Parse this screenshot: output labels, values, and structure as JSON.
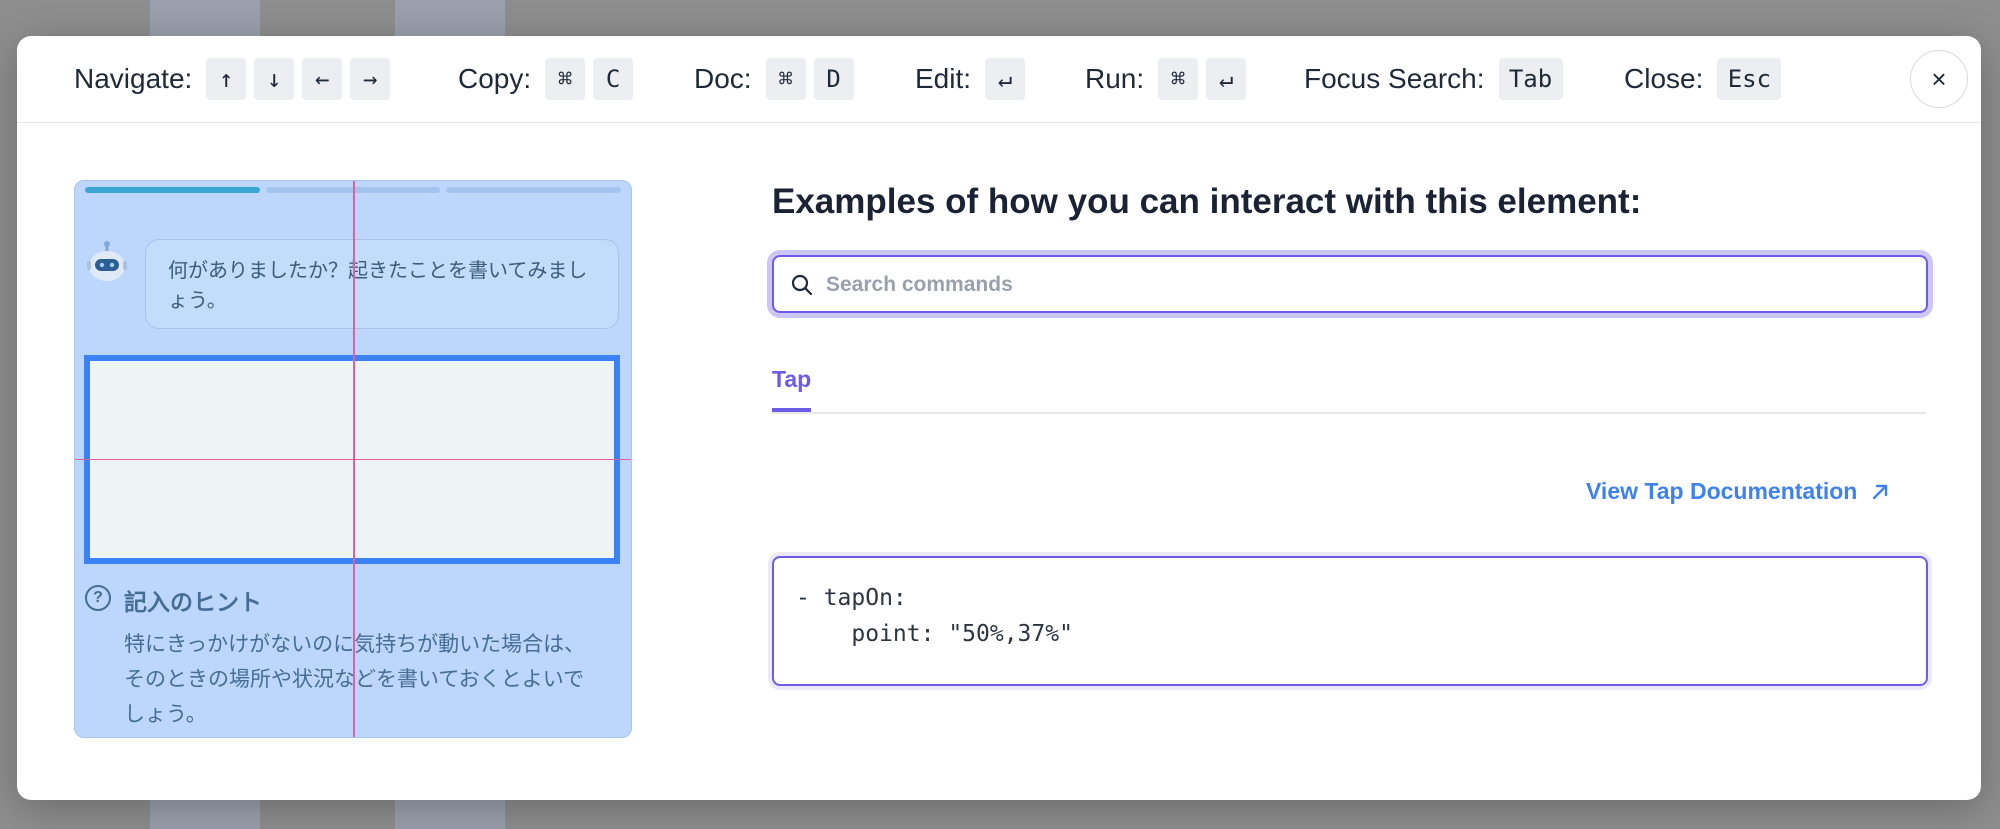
{
  "shortcuts": {
    "navigate": {
      "label": "Navigate:",
      "keys": [
        "↑",
        "↓",
        "←",
        "→"
      ]
    },
    "copy": {
      "label": "Copy:",
      "keys": [
        "⌘",
        "C"
      ]
    },
    "doc": {
      "label": "Doc:",
      "keys": [
        "⌘",
        "D"
      ]
    },
    "edit": {
      "label": "Edit:",
      "keys": [
        "↵"
      ]
    },
    "run": {
      "label": "Run:",
      "keys": [
        "⌘",
        "↵"
      ]
    },
    "focus_search": {
      "label": "Focus Search:",
      "keys": [
        "Tab"
      ]
    },
    "close": {
      "label": "Close:",
      "keys": [
        "Esc"
      ]
    }
  },
  "close_button": {
    "icon": "close-icon",
    "glyph": "×"
  },
  "preview": {
    "progress_segments": 3,
    "progress_active": 1,
    "bubble_text": "何がありましたか？起きたことを書いてみましょう。",
    "hint_icon_glyph": "?",
    "hint_title": "記入のヒント",
    "hint_body": "特にきっかけがないのに気持ちが動いた場合は、そのときの場所や状況などを書いておくとよいでしょう。",
    "colors": {
      "background": "#bcd7fb",
      "input_border": "#3b82f6",
      "crosshair": "#e45fa0",
      "hint_text": "#466d95"
    }
  },
  "panel": {
    "heading": "Examples of how you can interact with this element:",
    "search": {
      "placeholder": "Search commands",
      "value": ""
    },
    "tabs": [
      {
        "label": "Tap",
        "active": true
      }
    ],
    "doc_link": {
      "label": "View Tap Documentation",
      "icon": "arrow-up-right-icon"
    },
    "code": "- tapOn:\n    point: \"50%,37%\""
  },
  "colors": {
    "accent": "#6d5ce6",
    "link": "#3f82ee",
    "text": "#1a2233"
  }
}
